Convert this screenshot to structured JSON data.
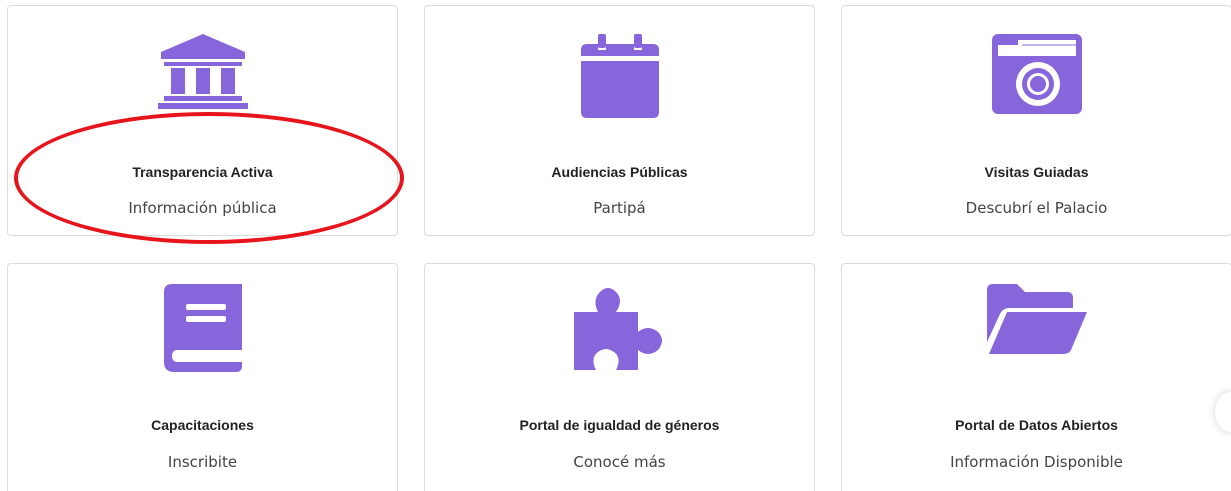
{
  "accent_color": "#8766dc",
  "highlight_color": "#e8141b",
  "cards": [
    {
      "title": "Transparencia Activa",
      "subtitle": "Información pública",
      "icon": "bank-building-icon"
    },
    {
      "title": "Audiencias Públicas",
      "subtitle": "Partipá",
      "icon": "calendar-icon"
    },
    {
      "title": "Visitas Guiadas",
      "subtitle": "Descubrí el Palacio",
      "icon": "camera-icon"
    },
    {
      "title": "Capacitaciones",
      "subtitle": "Inscribite",
      "icon": "book-icon"
    },
    {
      "title": "Portal de igualdad de géneros",
      "subtitle": "Conocé más",
      "icon": "puzzle-piece-icon"
    },
    {
      "title": "Portal de Datos Abiertos",
      "subtitle": "Información Disponible",
      "icon": "folder-open-icon"
    }
  ]
}
